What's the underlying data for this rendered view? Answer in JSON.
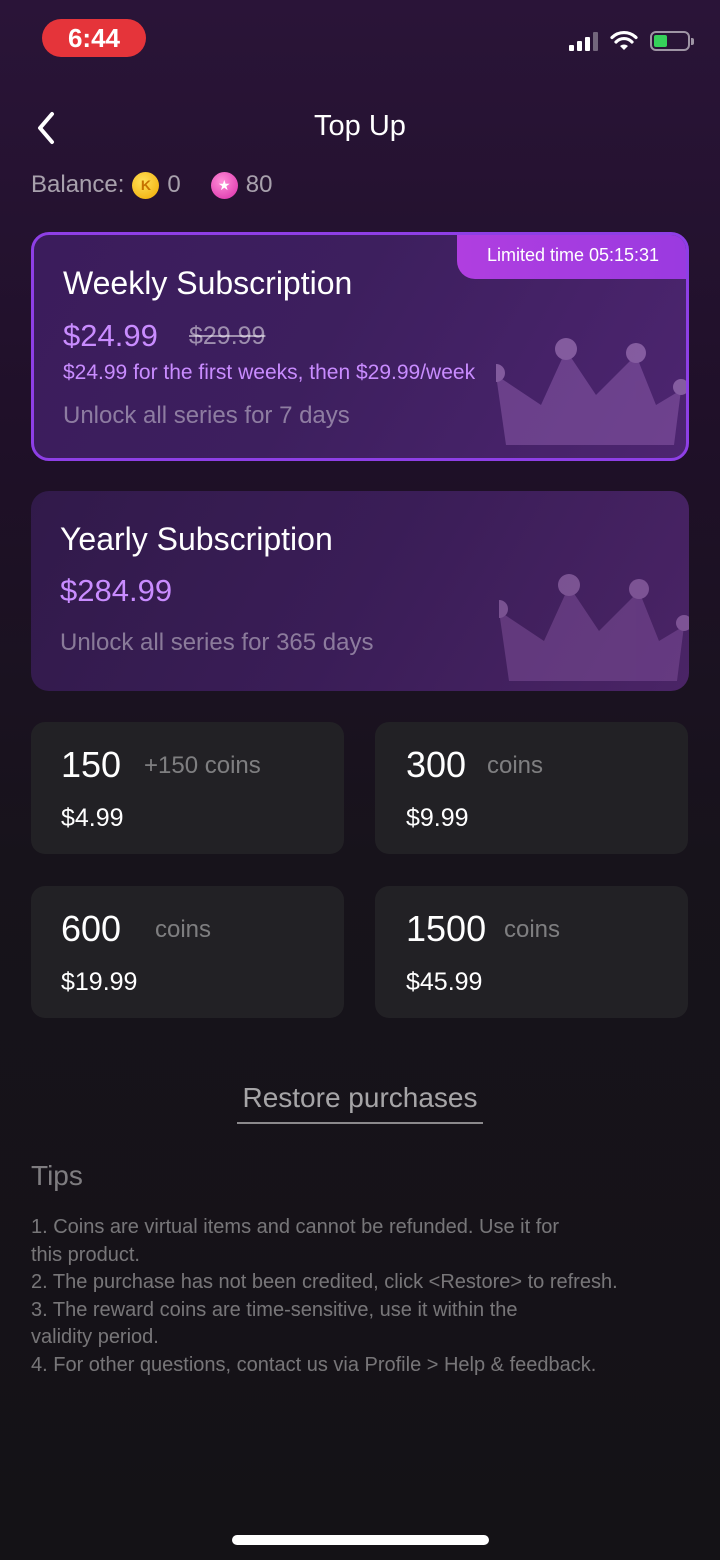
{
  "status": {
    "time": "6:44"
  },
  "header": {
    "title": "Top Up"
  },
  "balance": {
    "label": "Balance:",
    "coins_k": "0",
    "coins_bonus": "80",
    "coin_k_glyph": "K",
    "coin_b_glyph": "★"
  },
  "weekly": {
    "badge": "Limited time 05:15:31",
    "title": "Weekly Subscription",
    "price": "$24.99",
    "old_price": "$29.99",
    "note": "$24.99 for the first weeks, then $29.99/week",
    "desc": "Unlock all series for 7 days"
  },
  "yearly": {
    "title": "Yearly Subscription",
    "price": "$284.99",
    "desc": "Unlock all series for 365 days"
  },
  "packs": [
    {
      "amount": "150",
      "extra": "+150 coins",
      "price": "$4.99"
    },
    {
      "amount": "300",
      "extra": "coins",
      "price": "$9.99"
    },
    {
      "amount": "600",
      "extra": "coins",
      "price": "$19.99"
    },
    {
      "amount": "1500",
      "extra": "coins",
      "price": "$45.99"
    }
  ],
  "restore_label": "Restore purchases",
  "tips": {
    "title": "Tips",
    "items": [
      "1. Coins are virtual items and cannot be refunded. Use it for\nthis product.",
      "2. The purchase has not been credited, click <Restore> to refresh.",
      "3. The reward coins are time-sensitive, use it within the\nvalidity period.",
      "4. For other questions, contact us via Profile > Help & feedback."
    ]
  },
  "colors": {
    "accent": "#c98cff",
    "border": "#8e3fe6",
    "badge": "#b03ee0",
    "status_red": "#e5343a"
  }
}
